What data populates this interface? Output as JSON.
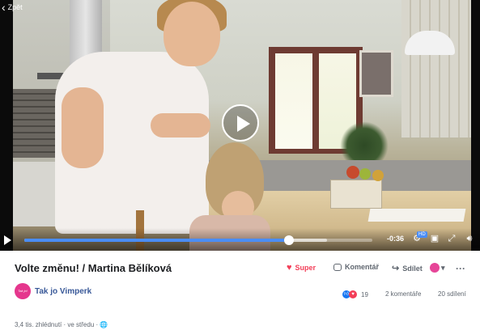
{
  "video": {
    "back_label": "Zpět",
    "time_remaining": "-0:36",
    "quality_badge": "HD",
    "progress_played": 0.76,
    "progress_buffered": 0.87,
    "accent_color": "#4a8df6"
  },
  "post": {
    "title": "Volte změnu! / Martina Bělíková",
    "page_name": "Tak jo Vimperk",
    "avatar_text": "Tak jo!",
    "meta": "3,4 tis. zhlédnutí · ve středu · 🌐"
  },
  "actions": {
    "like_label": "Super",
    "comment_label": "Komentář",
    "share_label": "Sdílet",
    "more_label": "···"
  },
  "stats": {
    "reactions_count": "19",
    "comments": "2 komentáře",
    "shares": "20 sdílení"
  },
  "icons": {
    "back": "chevron-left-icon",
    "play": "play-icon",
    "settings": "gear-icon",
    "miniplayer": "miniplayer-icon",
    "fullscreen": "fullscreen-icon",
    "volume": "speaker-icon"
  }
}
